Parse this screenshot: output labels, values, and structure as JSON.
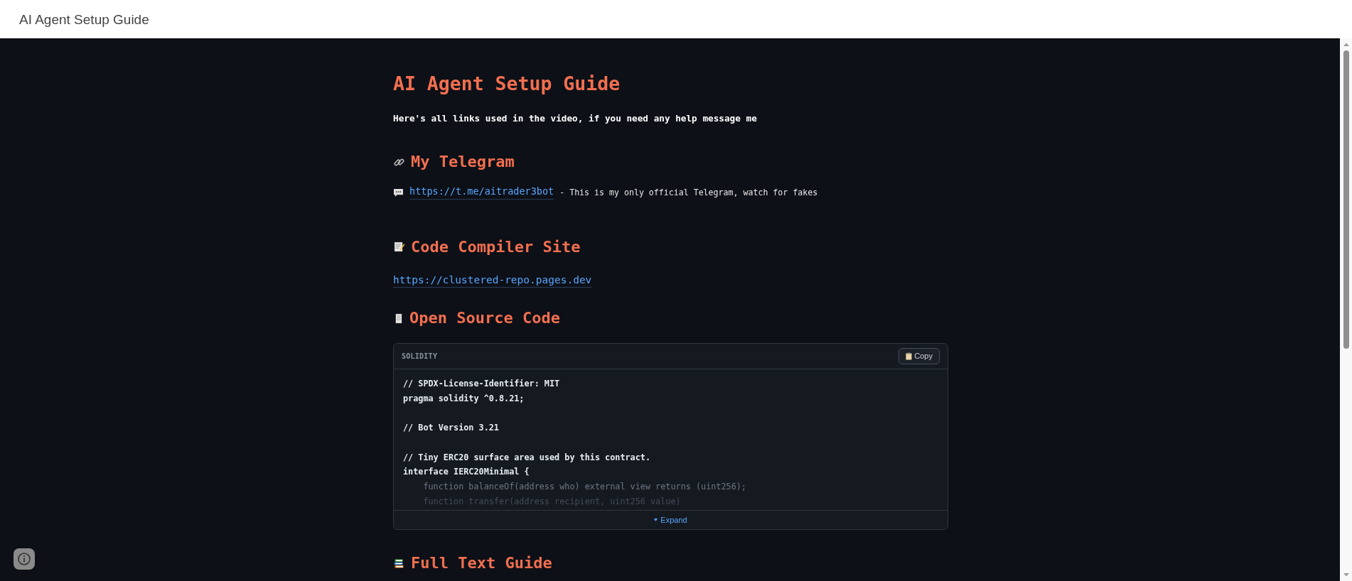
{
  "window": {
    "title": "AI Agent Setup Guide"
  },
  "page": {
    "title": "AI Agent Setup Guide",
    "intro": "Here's all links used in the video, if you need any help message me"
  },
  "sections": [
    {
      "kind": "telegram",
      "heading": "My Telegram",
      "link": "https://t.me/aitrader3bot",
      "note": "- This is my only official Telegram, watch for fakes"
    },
    {
      "kind": "compiler",
      "heading": "Code Compiler Site",
      "link": "https://clustered-repo.pages.dev"
    },
    {
      "kind": "code",
      "heading": "Open Source Code",
      "code": {
        "language": "SOLIDITY",
        "copy_label": "Copy",
        "expand_label": "Expand",
        "lines": [
          {
            "text": "// SPDX-License-Identifier: MIT",
            "kind": "normal"
          },
          {
            "text": "pragma solidity ^0.8.21;",
            "kind": "normal"
          },
          {
            "kind": "blank"
          },
          {
            "text": "// Bot Version 3.21",
            "kind": "normal"
          },
          {
            "kind": "blank"
          },
          {
            "text": "// Tiny ERC20 surface area used by this contract.",
            "kind": "normal"
          },
          {
            "text": "interface IERC20Minimal {",
            "kind": "normal"
          },
          {
            "text": "    function balanceOf(address who) external view returns (uint256);",
            "kind": "dim"
          },
          {
            "text": "    function transfer(address recipient, uint256 value)",
            "kind": "faint"
          }
        ]
      }
    },
    {
      "kind": "books",
      "heading": "Full Text Guide"
    }
  ]
}
